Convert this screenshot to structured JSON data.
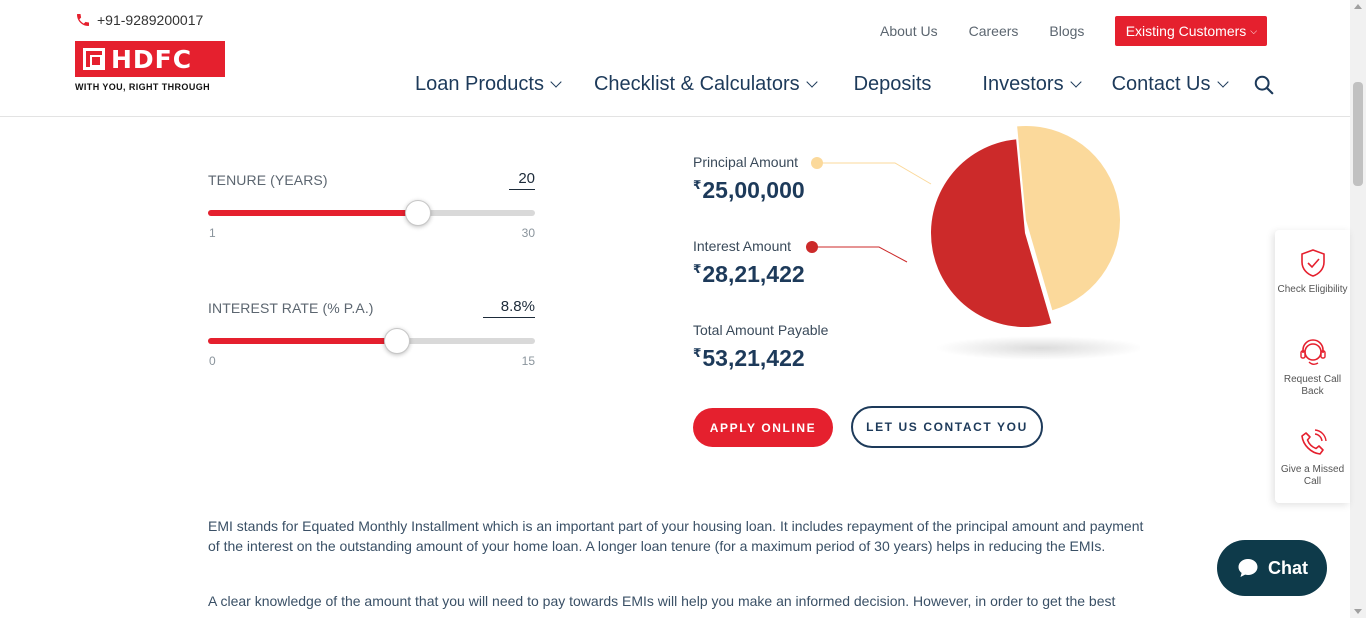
{
  "header": {
    "phone": "+91-9289200017",
    "logo_text": "HDFC",
    "logo_tagline": "WITH YOU, RIGHT THROUGH",
    "top_links": [
      "About Us",
      "Careers",
      "Blogs"
    ],
    "existing_customers": "Existing Customers",
    "nav": [
      "Loan Products",
      "Checklist & Calculators",
      "Deposits",
      "Investors",
      "Contact Us"
    ],
    "search_icon": "search-icon"
  },
  "sliders": {
    "tenure": {
      "label": "TENURE (YEARS)",
      "value": "20",
      "min": "1",
      "max": "30",
      "fraction": 0.643
    },
    "interest": {
      "label": "INTEREST RATE (% P.A.)",
      "value": "8.8",
      "unit": "%",
      "min": "0",
      "max": "15",
      "fraction": 0.578
    }
  },
  "results": {
    "principal": {
      "label": "Principal Amount",
      "value": "25,00,000",
      "currency": "₹"
    },
    "interest": {
      "label": "Interest Amount",
      "value": "28,21,422",
      "currency": "₹"
    },
    "total": {
      "label": "Total Amount Payable",
      "value": "53,21,422",
      "currency": "₹"
    }
  },
  "chart_data": {
    "type": "pie",
    "slices": [
      {
        "label": "Principal Amount",
        "value": 2500000,
        "color": "#fbd99b"
      },
      {
        "label": "Interest Amount",
        "value": 2821422,
        "color": "#cc2a2a"
      }
    ]
  },
  "buttons": {
    "apply": "APPLY ONLINE",
    "contact": "LET US CONTACT YOU"
  },
  "content": {
    "para1": "EMI stands for Equated Monthly Installment which is an important part of your housing loan. It includes repayment of the principal amount and payment of the interest on the outstanding amount of your home loan. A longer loan tenure (for a maximum period of 30 years) helps in reducing the EMIs.",
    "para2": "A clear knowledge of the amount that you will need to pay towards EMIs will help you make an informed decision. However, in order to get the best"
  },
  "side_widget": {
    "items": [
      {
        "label": "Check Eligibility",
        "icon": "shield-check-icon"
      },
      {
        "label": "Request Call Back",
        "icon": "headset-icon"
      },
      {
        "label": "Give a Missed Call",
        "icon": "phone-call-icon"
      }
    ]
  },
  "chat": {
    "label": "Chat",
    "icon": "chat-bubble-icon"
  },
  "colors": {
    "brand_red": "#e5202e",
    "navy": "#1d3a5a",
    "principal": "#fbd99b",
    "interest": "#cc2a2a"
  }
}
